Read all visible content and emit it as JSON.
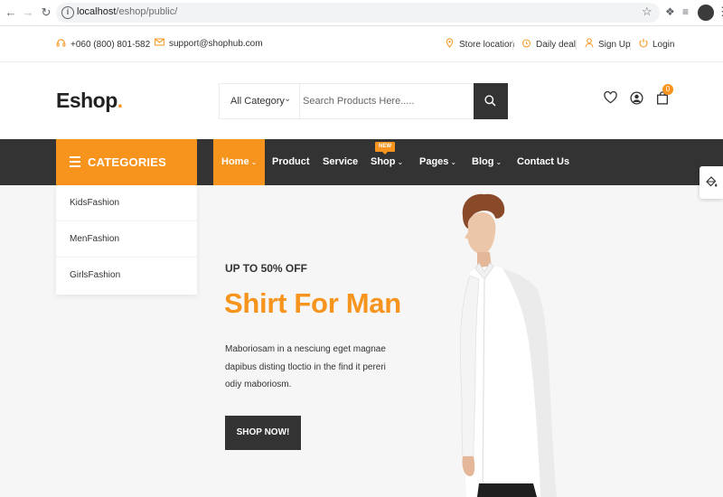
{
  "browser": {
    "url_host": "localhost",
    "url_path": "/eshop/public/"
  },
  "topbar": {
    "phone": "+060 (800) 801-582",
    "email": "support@shophub.com",
    "links": [
      {
        "label": "Store location",
        "icon": "map-pin-icon"
      },
      {
        "label": "Daily deal",
        "icon": "alarm-clock-icon"
      },
      {
        "label": "Sign Up",
        "icon": "user-icon"
      },
      {
        "label": "Login",
        "icon": "power-icon"
      }
    ]
  },
  "header": {
    "logo_text": "Eshop",
    "logo_dot": ".",
    "category_select": "All Category",
    "search_placeholder": "Search Products Here.....",
    "cart_count": "0"
  },
  "nav": {
    "categories_label": "CATEGORIES",
    "items": [
      {
        "label": "Home",
        "dropdown": true,
        "active": true
      },
      {
        "label": "Product",
        "dropdown": false
      },
      {
        "label": "Service",
        "dropdown": false
      },
      {
        "label": "Shop",
        "dropdown": true
      },
      {
        "label": "Pages",
        "dropdown": true
      },
      {
        "label": "Blog",
        "dropdown": true
      },
      {
        "label": "Contact Us",
        "dropdown": false
      }
    ],
    "new_tag": "NEW"
  },
  "categories": [
    "KidsFashion",
    "MenFashion",
    "GirlsFashion"
  ],
  "hero": {
    "kicker": "UP TO 50% OFF",
    "title": "Shirt For Man",
    "description": "Maboriosam in a nesciung eget magnae dapibus disting tloctio in the find it pereri odiy maboriosm.",
    "cta": "SHOP NOW!"
  },
  "colors": {
    "accent": "#f7941d",
    "dark": "#333333",
    "hero_bg": "#f6f6f6"
  }
}
